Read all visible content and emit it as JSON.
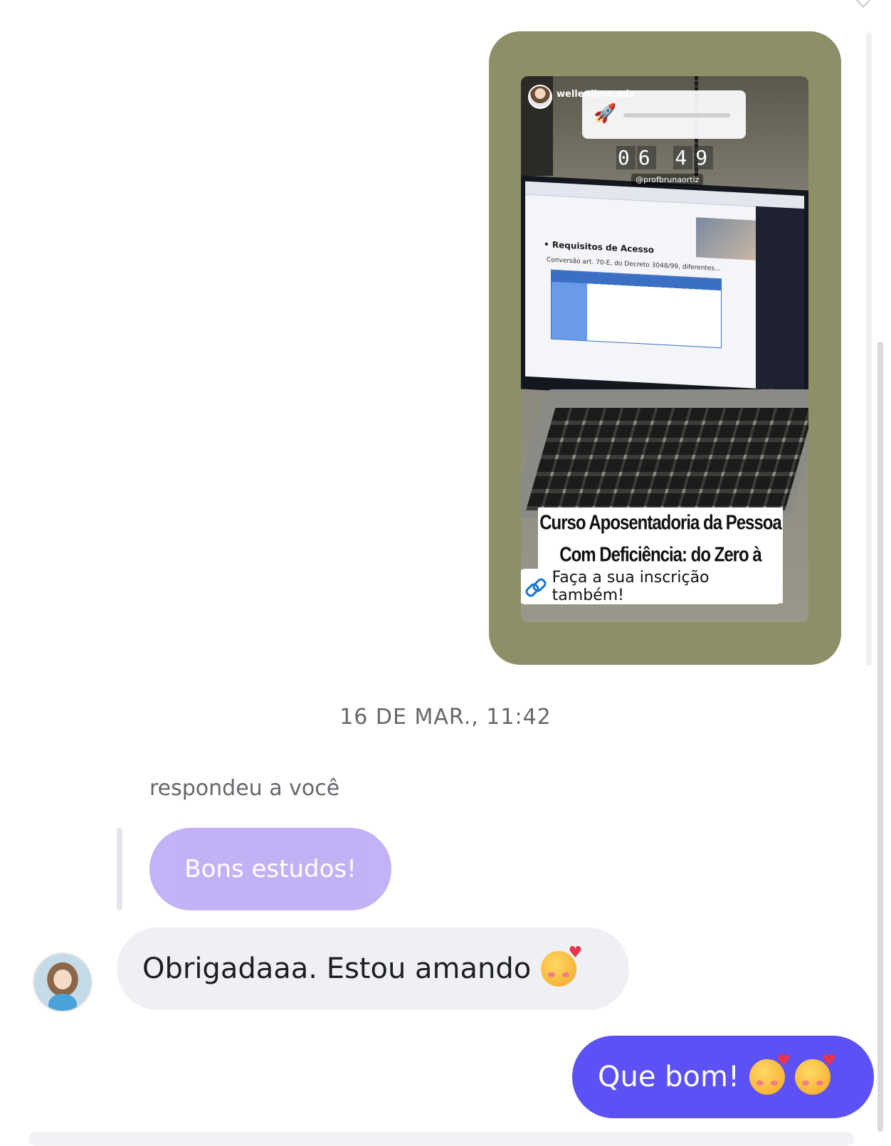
{
  "story": {
    "username": "wellenlima.adv",
    "countdown": [
      "0",
      "6",
      "4",
      "9"
    ],
    "mention": "@profbrunaortiz",
    "slide_title": "• Requisitos de Acesso",
    "slide_subtitle": "Conversão art. 70-E, do Decreto 3048/99, diferentes...",
    "course_title_line1": "Curso Aposentadoria da Pessoa",
    "course_title_line2": "Com Deficiência: do Zero à Prática",
    "link_text": "Faça a sua inscrição também!",
    "card_color": "#8e8e67"
  },
  "conversation": {
    "timestamp": "16 DE MAR., 11:42",
    "reply_label": "respondeu a você",
    "quoted_message": "Bons estudos!",
    "incoming_message": "Obrigadaaa. Estou amando",
    "outgoing_message": "Que bom!",
    "outgoing_color": "#5b51f5",
    "quoted_color": "#b8a5f4"
  }
}
